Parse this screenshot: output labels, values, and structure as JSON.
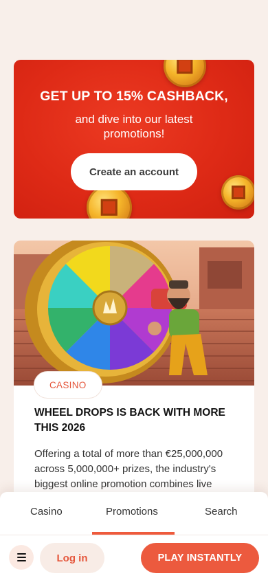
{
  "promo": {
    "headline": "GET UP TO 15% CASHBACK,",
    "subtext": "and dive into our latest promotions!",
    "cta_label": "Create an account",
    "colors": {
      "background": "#de2a16",
      "text": "#ffffff"
    }
  },
  "article": {
    "image": "wheel-drops-promo-art",
    "tag": "CASINO",
    "title": "WHEEL DROPS IS BACK WITH MORE THIS 2026",
    "body": "Offering a total of more than €25,000,000 across 5,000,000+ prizes, the industry's biggest online promotion combines live"
  },
  "tabs": [
    {
      "label": "Casino",
      "active": false
    },
    {
      "label": "Promotions",
      "active": true
    },
    {
      "label": "Search",
      "active": false
    }
  ],
  "actions": {
    "menu_icon": "hamburger-menu-icon",
    "login_label": "Log in",
    "play_label": "PLAY INSTANTLY"
  },
  "colors": {
    "page_background": "#f8efea",
    "accent": "#ec5a3e",
    "tag_text": "#e5563b"
  }
}
